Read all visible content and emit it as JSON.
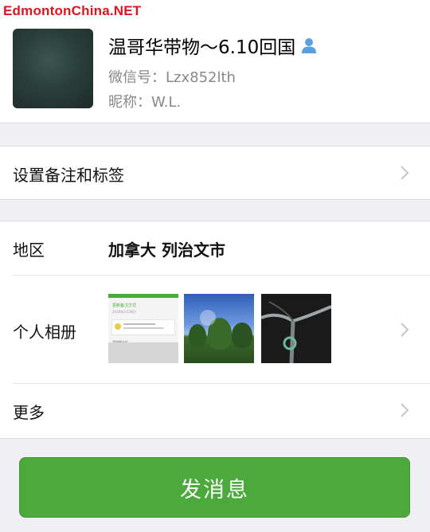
{
  "watermark": "EdmontonChina.NET",
  "profile": {
    "name": "温哥华带物～6.10回国",
    "wechat_id": "微信号：Lzx852lth",
    "nickname": "昵称：W.L."
  },
  "remark_row": {
    "label": "设置备注和标签"
  },
  "info": {
    "region_label": "地区",
    "region_value": "加拿大 列治文市",
    "album_label": "个人相册",
    "more_label": "更多"
  },
  "album_thumb1": {
    "header": "更新备注方式",
    "lines": [
      "2018年5月28日"
    ],
    "footer": "添加到卡片"
  },
  "send_button": {
    "label": "发消息"
  },
  "colors": {
    "accent_green": "#4ca93c",
    "watermark_red": "#e0141e",
    "page_bg": "#efeff4"
  },
  "icons": [
    "person-icon",
    "chevron-right-icon"
  ]
}
